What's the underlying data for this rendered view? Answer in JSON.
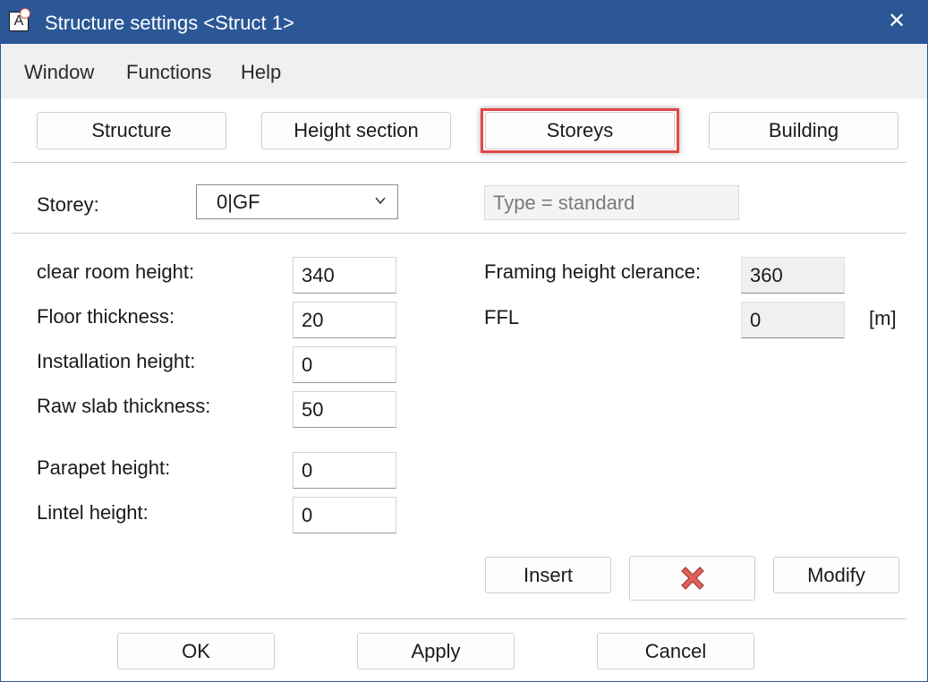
{
  "window": {
    "title": "Structure settings <Struct 1>",
    "app_icon_letter": "A",
    "close_glyph": "✕",
    "titlebar_color": "#2b5797"
  },
  "menu": {
    "items": [
      "Window",
      "Functions",
      "Help"
    ]
  },
  "tabs": [
    {
      "label": "Structure",
      "selected": false
    },
    {
      "label": "Height section",
      "selected": false
    },
    {
      "label": "Storeys",
      "selected": true
    },
    {
      "label": "Building",
      "selected": false
    }
  ],
  "storey": {
    "label": "Storey:",
    "value": "0|GF",
    "type_text": "Type = standard"
  },
  "fields": [
    {
      "label": "clear room height:",
      "value": "340"
    },
    {
      "label": "Floor thickness:",
      "value": "20"
    },
    {
      "label": "Installation height:",
      "value": "0"
    },
    {
      "label": "Raw slab thickness:",
      "value": "50"
    },
    {
      "label": "Parapet height:",
      "value": "0"
    },
    {
      "label": "Lintel height:",
      "value": "0"
    }
  ],
  "right_fields": [
    {
      "label": "Framing height clerance:",
      "value": "360"
    },
    {
      "label": "FFL",
      "value": "0"
    }
  ],
  "unit": "[m]",
  "actions": {
    "insert": "Insert",
    "delete_icon": "red-x-icon",
    "modify": "Modify"
  },
  "footer": {
    "ok": "OK",
    "apply": "Apply",
    "cancel": "Cancel"
  },
  "colors": {
    "highlight": "#e04848",
    "delete_x": "#e0605a"
  }
}
